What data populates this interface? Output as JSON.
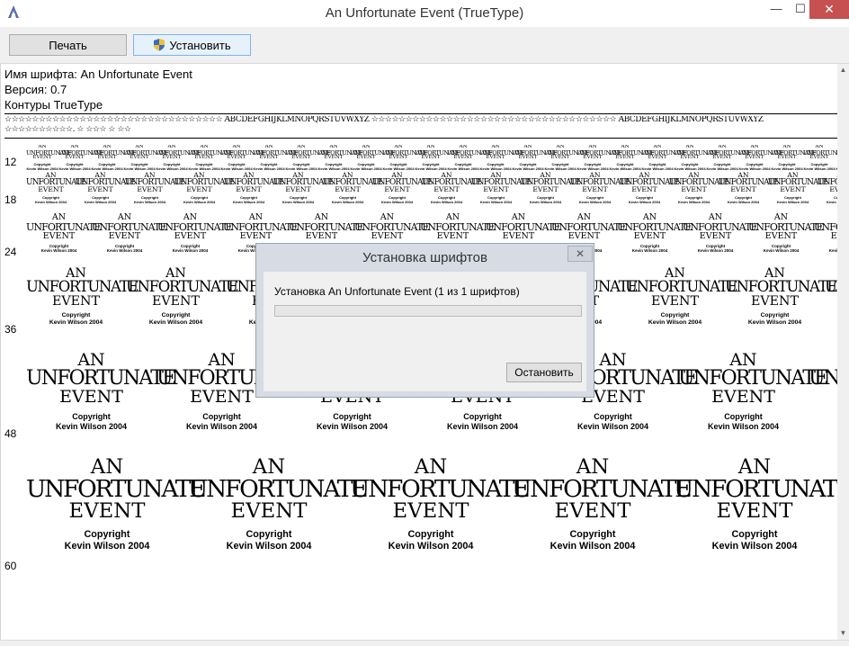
{
  "window": {
    "title": "An Unfortunate Event (TrueType)",
    "minimize_glyph": "—",
    "maximize_glyph": "☐",
    "close_glyph": "✕"
  },
  "toolbar": {
    "print_label": "Печать",
    "install_label": "Установить"
  },
  "font_info": {
    "name_line": "Имя шрифта: An Unfortunate Event",
    "version_line": "Версия: 0.7",
    "outline_line": "Контуры TrueType"
  },
  "charset_line1": "☆☆☆☆☆☆☆☆☆☆☆☆☆☆☆☆☆☆☆☆☆☆☆☆☆☆☆☆☆☆☆☆ ABCDEFGHIJKLMNOPQRSTUVWXYZ ☆☆☆☆☆☆☆☆☆☆☆☆☆☆☆☆☆☆☆☆☆☆☆☆☆☆☆☆☆☆☆☆☆☆☆☆ ABCDEFGHIJKLMNOPQRSTUVWXYZ",
  "charset_line2": "☆☆☆☆☆☆☆☆☆☆. ☆ ☆☆☆ ☆ ☆☆",
  "sample": {
    "an": "AN",
    "unfortunate": "UNFORTUNATE",
    "event": "EVENT",
    "copyright": "Copyright",
    "author": "Kevin Wilson 2004"
  },
  "sizes": [
    "12",
    "18",
    "24",
    "36",
    "48",
    "60"
  ],
  "dialog": {
    "title": "Установка шрифтов",
    "close_glyph": "✕",
    "message": "Установка An Unfortunate Event (1 из 1 шрифтов)",
    "progress": 0,
    "stop_label": "Остановить"
  },
  "scrollbar": {
    "up_glyph": "▲",
    "down_glyph": "▼"
  }
}
